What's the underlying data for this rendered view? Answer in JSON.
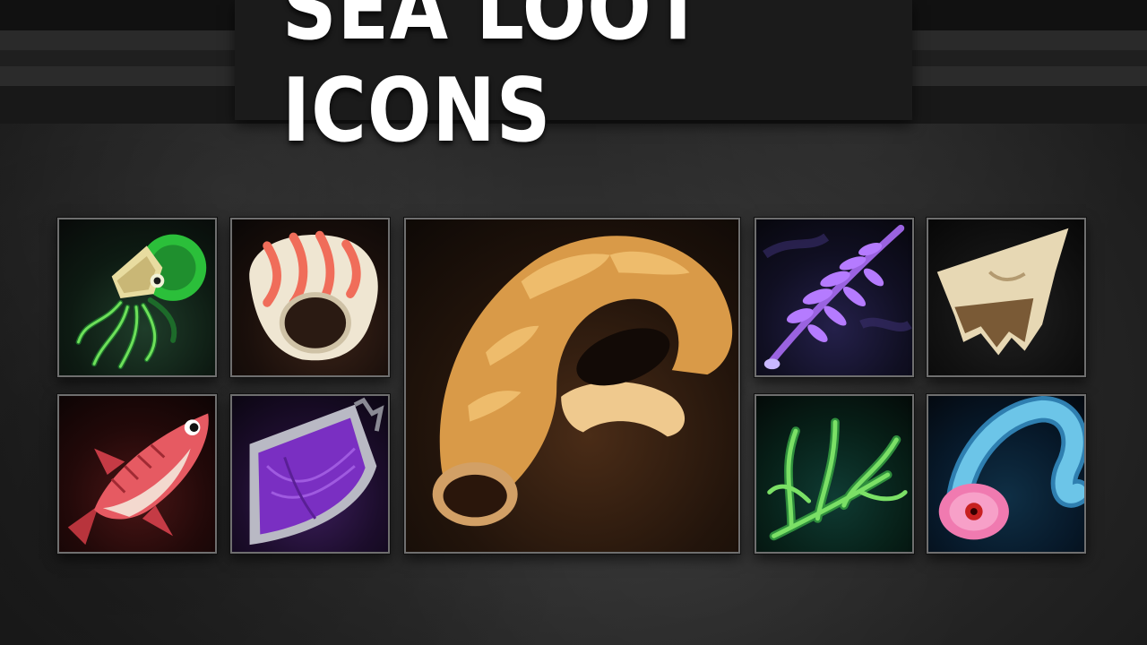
{
  "title": "SEA LOOT ICONS",
  "icons": [
    {
      "name": "nautilus-icon",
      "tint": "#2e5a3a"
    },
    {
      "name": "spiral-shell-icon",
      "tint": "#4a2a1c"
    },
    {
      "name": "red-fish-icon",
      "tint": "#5a1a1a"
    },
    {
      "name": "purple-scale-icon",
      "tint": "#4a2470"
    },
    {
      "name": "horn-shell-icon",
      "tint": "#5a3418"
    },
    {
      "name": "purple-coral-icon",
      "tint": "#2a2656"
    },
    {
      "name": "bone-fragment-icon",
      "tint": "#2a2a2a"
    },
    {
      "name": "green-seaweed-icon",
      "tint": "#124a40"
    },
    {
      "name": "blue-tentacle-icon",
      "tint": "#123a55"
    }
  ]
}
